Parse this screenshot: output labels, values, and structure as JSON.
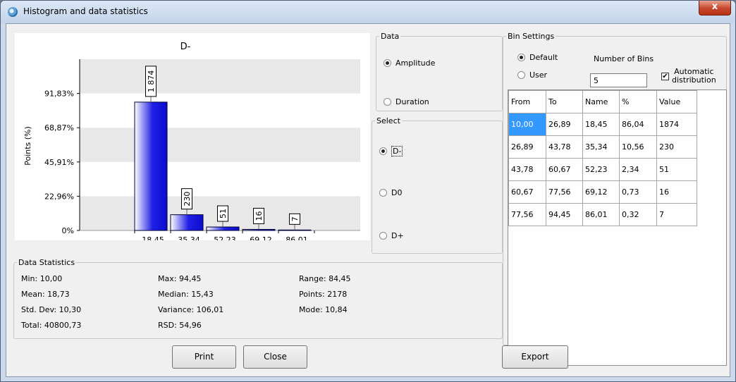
{
  "window": {
    "title": "Histogram and data statistics",
    "close_glyph": "x"
  },
  "chart_data": {
    "type": "bar",
    "title": "D-",
    "ylabel": "Points (%)",
    "xlabel": "",
    "categories": [
      "18,45",
      "35,34",
      "52,23",
      "69,12",
      "86,01"
    ],
    "values": [
      86.04,
      10.56,
      2.34,
      0.73,
      0.32
    ],
    "data_labels": [
      "1 874",
      "230",
      "51",
      "16",
      "7"
    ],
    "yticks": [
      {
        "value": 0,
        "label": "0%"
      },
      {
        "value": 22.96,
        "label": "22,96%"
      },
      {
        "value": 45.91,
        "label": "45,91%"
      },
      {
        "value": 68.87,
        "label": "68,87%"
      },
      {
        "value": 91.83,
        "label": "91,83%"
      }
    ],
    "ylim": [
      0,
      114.8
    ],
    "grid": "alternating bands",
    "legend": "none",
    "bar_color": "#1f1fe6"
  },
  "data_group": {
    "legend": "Data",
    "options": [
      {
        "label": "Amplitude",
        "selected": true
      },
      {
        "label": "Duration",
        "selected": false
      }
    ]
  },
  "select_group": {
    "legend": "Select",
    "options": [
      {
        "label": "D-",
        "selected": true
      },
      {
        "label": "D0",
        "selected": false
      },
      {
        "label": "D+",
        "selected": false
      }
    ]
  },
  "bin_settings": {
    "legend": "Bin Settings",
    "default_label": "Default",
    "user_label": "User",
    "num_bins_label": "Number of Bins",
    "num_bins_value": "5",
    "auto_line1": "Automatic",
    "auto_line2": "distribution",
    "auto_checked": "✔",
    "columns": [
      "From",
      "To",
      "Name",
      "%",
      "Value"
    ],
    "rows": [
      [
        "10,00",
        "26,89",
        "18,45",
        "86,04",
        "1874"
      ],
      [
        "26,89",
        "43,78",
        "35,34",
        "10,56",
        "230"
      ],
      [
        "43,78",
        "60,67",
        "52,23",
        "2,34",
        "51"
      ],
      [
        "60,67",
        "77,56",
        "69,12",
        "0,73",
        "16"
      ],
      [
        "77,56",
        "94,45",
        "86,01",
        "0,32",
        "7"
      ]
    ]
  },
  "stats": {
    "legend": "Data Statistics",
    "min": "Min: 10,00",
    "mean": "Mean: 18,73",
    "std": "Std. Dev: 10,30",
    "total": "Total: 40800,73",
    "max": "Max: 94,45",
    "median": "Median: 15,43",
    "variance": "Variance: 106,01",
    "rsd": "RSD: 54,96",
    "range": "Range: 84,45",
    "points": "Points: 2178",
    "mode": "Mode: 10,84"
  },
  "buttons": {
    "print": "Print",
    "close": "Close",
    "export": "Export"
  }
}
